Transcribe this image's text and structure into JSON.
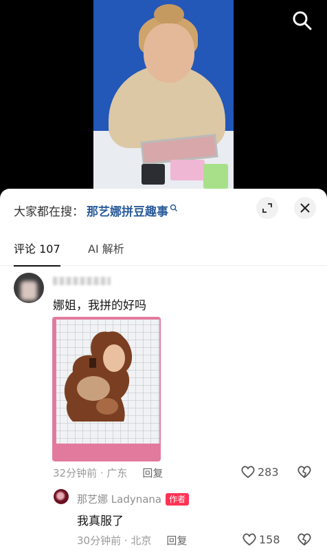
{
  "sheet": {
    "search_prefix": "大家都在搜：",
    "search_term": "那艺娜拼豆趣事"
  },
  "tabs": [
    {
      "label": "评论 107"
    },
    {
      "label": "AI 解析"
    }
  ],
  "comments": [
    {
      "text": "娜姐，我拼的好吗",
      "time": "32分钟前 · 广东",
      "reply_label": "回复",
      "likes": "283"
    }
  ],
  "reply": {
    "author": "那艺娜 Ladynana",
    "badge": "作者",
    "text": "我真服了",
    "time": "30分钟前 · 北京",
    "reply_label": "回复",
    "likes": "158"
  },
  "icons": {
    "search": "search-icon",
    "expand": "expand-icon",
    "close": "close-icon",
    "like": "heart-icon",
    "dislike": "broken-heart-icon"
  },
  "colors": {
    "link_blue": "#2b5c9b",
    "author_badge": "#ff3355"
  }
}
